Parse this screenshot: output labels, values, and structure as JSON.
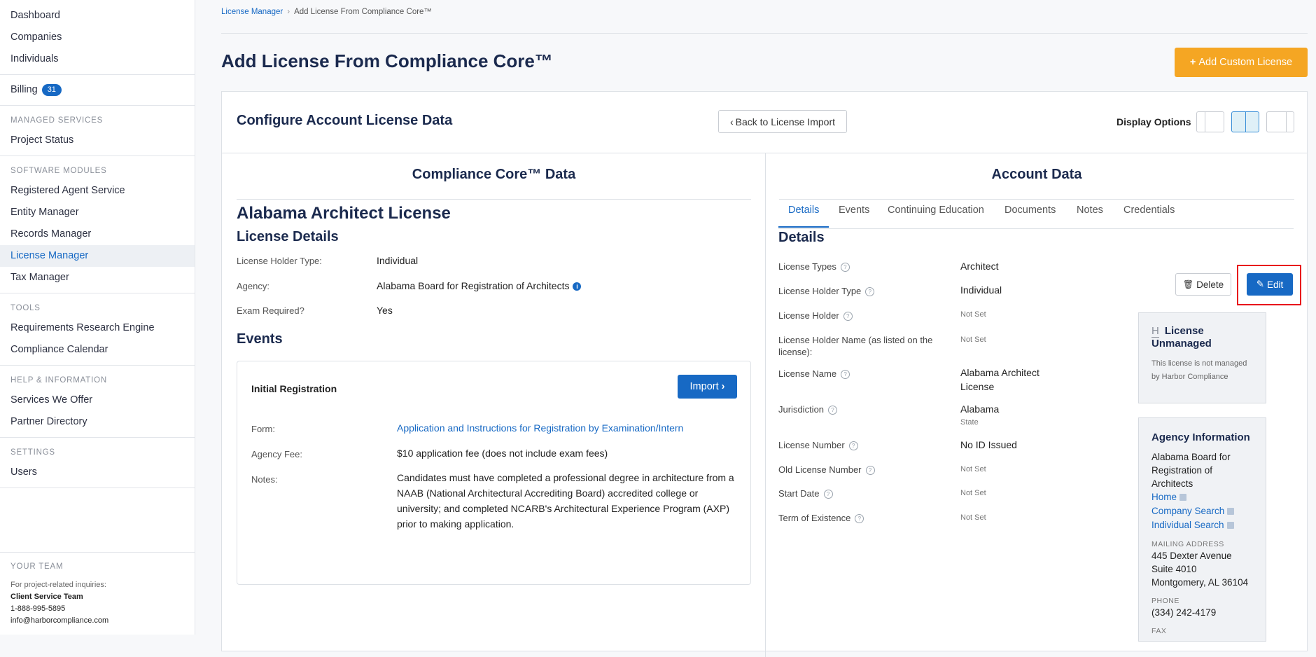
{
  "sidebar": {
    "items_top": [
      "Dashboard",
      "Companies",
      "Individuals"
    ],
    "billing": {
      "label": "Billing",
      "badge": "31"
    },
    "sections": [
      {
        "title": "MANAGED SERVICES",
        "items": [
          "Project Status"
        ]
      },
      {
        "title": "SOFTWARE MODULES",
        "items": [
          "Registered Agent Service",
          "Entity Manager",
          "Records Manager",
          "License Manager",
          "Tax Manager"
        ]
      },
      {
        "title": "TOOLS",
        "items": [
          "Requirements Research Engine",
          "Compliance Calendar"
        ]
      },
      {
        "title": "HELP & INFORMATION",
        "items": [
          "Services We Offer",
          "Partner Directory"
        ]
      },
      {
        "title": "SETTINGS",
        "items": [
          "Users"
        ]
      }
    ],
    "team": {
      "title": "YOUR TEAM",
      "note": "For project-related inquiries:",
      "name": "Client Service Team",
      "phone": "1-888-995-5895",
      "email": "info@harborcompliance.com"
    }
  },
  "breadcrumb": {
    "link": "License Manager",
    "sep": "›",
    "current": "Add License From Compliance Core™"
  },
  "page": {
    "title": "Add License From Compliance Core™",
    "add_custom": "Add Custom License"
  },
  "card": {
    "title": "Configure Account License Data",
    "back": "Back to License Import",
    "display_options": "Display Options"
  },
  "left": {
    "heading": "Compliance Core™ Data",
    "license_title": "Alabama Architect License",
    "details_heading": "License Details",
    "fields": [
      {
        "label": "License Holder Type:",
        "value": "Individual"
      },
      {
        "label": "Agency:",
        "value": "Alabama Board for Registration of Architects"
      },
      {
        "label": "Exam Required?",
        "value": "Yes"
      }
    ],
    "events_heading": "Events",
    "event": {
      "title": "Initial Registration",
      "import": "Import",
      "form_label": "Form:",
      "form_value": "Application and Instructions for Registration by Examination/Intern",
      "fee_label": "Agency Fee:",
      "fee_value": "$10 application fee (does not include exam fees)",
      "notes_label": "Notes:",
      "notes_value": "Candidates must have completed a professional degree in architecture from a NAAB (National Architectural Accrediting Board) accredited college or university; and completed NCARB's Architectural Experience Program (AXP) prior to making application."
    }
  },
  "right": {
    "heading": "Account Data",
    "tabs": [
      "Details",
      "Events",
      "Continuing Education",
      "Documents",
      "Notes",
      "Credentials"
    ],
    "details_heading": "Details",
    "delete": "Delete",
    "edit": "Edit",
    "fields": [
      {
        "label": "License Types",
        "value": "Architect"
      },
      {
        "label": "License Holder Type",
        "value": "Individual"
      },
      {
        "label": "License Holder",
        "value": "Not Set"
      },
      {
        "label": "License Holder Name (as listed on the license):",
        "value": "Not Set"
      },
      {
        "label": "License Name",
        "value": "Alabama Architect License"
      },
      {
        "label": "Jurisdiction",
        "value": "Alabama",
        "sub": "State"
      },
      {
        "label": "License Number",
        "value": "No ID Issued"
      },
      {
        "label": "Old License Number",
        "value": "Not Set"
      },
      {
        "label": "Start Date",
        "value": "Not Set"
      },
      {
        "label": "Term of Existence",
        "value": "Not Set"
      }
    ],
    "unmanaged": {
      "icon": "H",
      "title": "License Unmanaged",
      "text": "This license is not managed by Harbor Compliance"
    },
    "agency": {
      "title": "Agency Information",
      "name": "Alabama Board for Registration of Architects",
      "links": [
        "Home",
        "Company Search",
        "Individual Search"
      ],
      "mailing_label": "MAILING ADDRESS",
      "address": [
        "445 Dexter Avenue",
        "Suite 4010",
        "Montgomery, AL 36104"
      ],
      "phone_label": "PHONE",
      "phone": "(334) 242-4179",
      "fax_label": "FAX"
    }
  },
  "colors": {
    "accent": "#1769c4",
    "orange": "#f5a623",
    "highlight": "#e8151b",
    "title": "#1b2a4e"
  }
}
